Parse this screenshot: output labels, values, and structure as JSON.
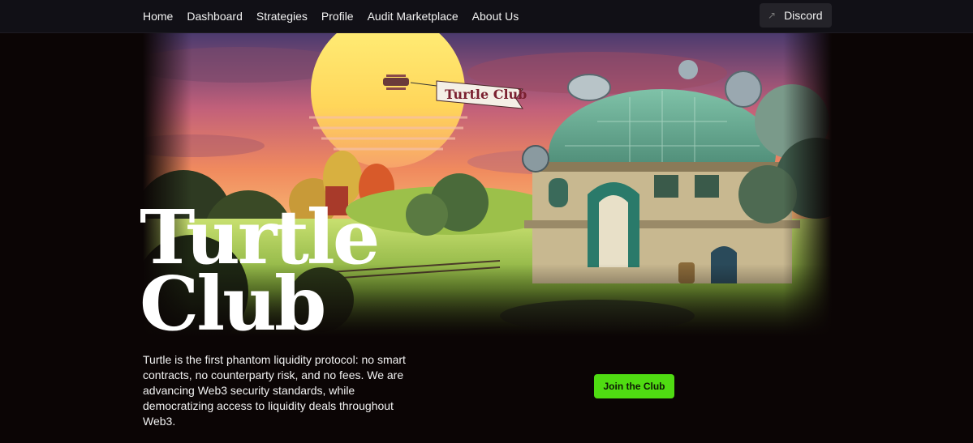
{
  "nav": {
    "links": [
      "Home",
      "Dashboard",
      "Strategies",
      "Profile",
      "Audit Marketplace",
      "About Us"
    ],
    "discord_label": "Discord",
    "discord_icon": "external-arrow-icon"
  },
  "hero": {
    "banner_text": "Turtle Club",
    "title_line1": "Turtle",
    "title_line2": "Club",
    "description": "Turtle is the first phantom liquidity protocol: no smart contracts, no counterparty risk, and no fees. We are advancing Web3 security standards, while democratizing access to liquidity deals throughout Web3.",
    "cta_label": "Join the Club"
  },
  "colors": {
    "background": "#0b0505",
    "nav_background": "#111016",
    "accent_green": "#4fdc12",
    "text": "#f2f2f2"
  }
}
